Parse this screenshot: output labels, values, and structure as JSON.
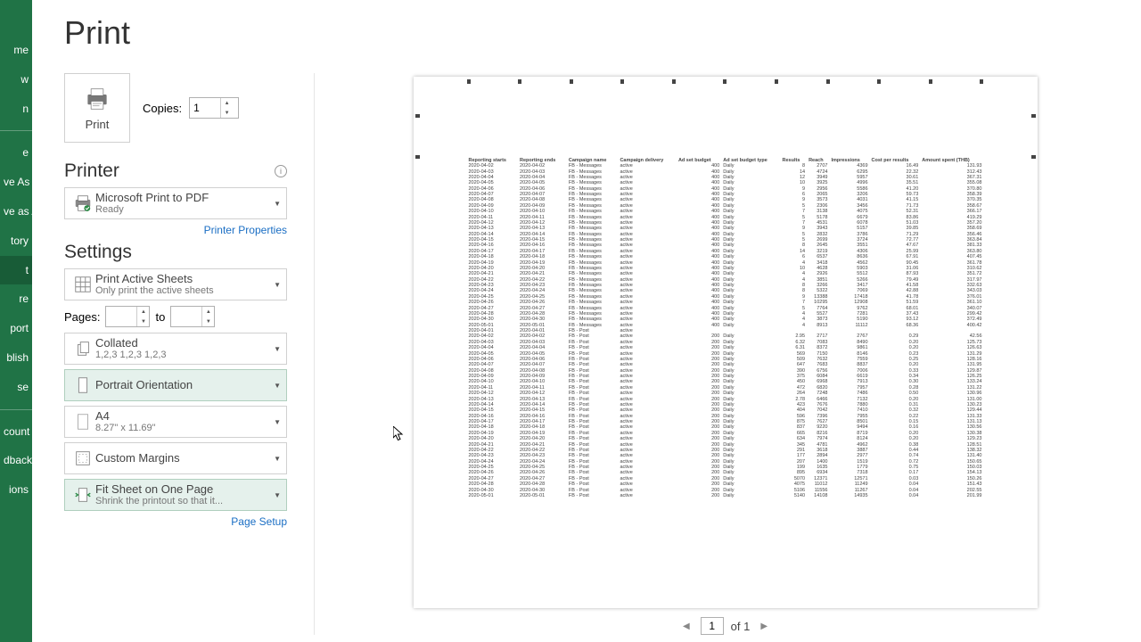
{
  "nav": {
    "items": [
      "me",
      "w",
      "n",
      "",
      "e",
      "ve As",
      "ve as Adobe\nF",
      "tory",
      "t",
      "re",
      "port",
      "blish",
      "se"
    ],
    "account_items": [
      "count",
      "dback",
      "ions"
    ],
    "selected_index": 8
  },
  "page_title": "Print",
  "print_button_label": "Print",
  "copies_label": "Copies:",
  "copies_value": "1",
  "printer": {
    "section": "Printer",
    "name": "Microsoft Print to PDF",
    "status": "Ready",
    "properties_link": "Printer Properties"
  },
  "settings": {
    "section": "Settings",
    "active_sheets": {
      "title": "Print Active Sheets",
      "sub": "Only print the active sheets"
    },
    "pages_label": "Pages:",
    "pages_to": "to",
    "collated": {
      "title": "Collated",
      "sub": "1,2,3    1,2,3    1,2,3"
    },
    "orientation": "Portrait Orientation",
    "paper": {
      "title": "A4",
      "sub": "8.27\" x 11.69\""
    },
    "margins": "Custom Margins",
    "fit": {
      "title": "Fit Sheet on One Page",
      "sub": "Shrink the printout so that it..."
    },
    "page_setup_link": "Page Setup"
  },
  "page_nav": {
    "current": "1",
    "total_text": "of 1"
  },
  "preview": {
    "headers": [
      "Reporting starts",
      "Reporting ends",
      "Campaign name",
      "Campaign delivery",
      "Ad set budget",
      "Ad set budget type",
      "Results",
      "Reach",
      "Impressions",
      "Cost per results",
      "Amount spent (THB)"
    ],
    "rows": [
      [
        "2020-04-02",
        "2020-04-02",
        "FB - Messages",
        "active",
        "400",
        "Daily",
        "8",
        "2707",
        "4369",
        "16.49",
        "131.93"
      ],
      [
        "2020-04-03",
        "2020-04-03",
        "FB - Messages",
        "active",
        "400",
        "Daily",
        "14",
        "4724",
        "6295",
        "22.32",
        "312.43"
      ],
      [
        "2020-04-04",
        "2020-04-04",
        "FB - Messages",
        "active",
        "400",
        "Daily",
        "12",
        "3949",
        "5957",
        "30.61",
        "367.31"
      ],
      [
        "2020-04-05",
        "2020-04-05",
        "FB - Messages",
        "active",
        "400",
        "Daily",
        "10",
        "3925",
        "4996",
        "35.51",
        "355.08"
      ],
      [
        "2020-04-06",
        "2020-04-06",
        "FB - Messages",
        "active",
        "400",
        "Daily",
        "9",
        "2956",
        "5586",
        "41.20",
        "370.80"
      ],
      [
        "2020-04-07",
        "2020-04-07",
        "FB - Messages",
        "active",
        "400",
        "Daily",
        "6",
        "2065",
        "3206",
        "59.73",
        "358.39"
      ],
      [
        "2020-04-08",
        "2020-04-08",
        "FB - Messages",
        "active",
        "400",
        "Daily",
        "9",
        "3573",
        "4031",
        "41.15",
        "370.35"
      ],
      [
        "2020-04-09",
        "2020-04-09",
        "FB - Messages",
        "active",
        "400",
        "Daily",
        "5",
        "2306",
        "3456",
        "71.73",
        "358.67"
      ],
      [
        "2020-04-10",
        "2020-04-10",
        "FB - Messages",
        "active",
        "400",
        "Daily",
        "7",
        "3138",
        "4075",
        "52.31",
        "366.17"
      ],
      [
        "2020-04-11",
        "2020-04-11",
        "FB - Messages",
        "active",
        "400",
        "Daily",
        "5",
        "5178",
        "6679",
        "83.86",
        "419.29"
      ],
      [
        "2020-04-12",
        "2020-04-12",
        "FB - Messages",
        "active",
        "400",
        "Daily",
        "7",
        "4531",
        "6078",
        "51.03",
        "357.20"
      ],
      [
        "2020-04-13",
        "2020-04-13",
        "FB - Messages",
        "active",
        "400",
        "Daily",
        "9",
        "3943",
        "5157",
        "39.85",
        "358.69"
      ],
      [
        "2020-04-14",
        "2020-04-14",
        "FB - Messages",
        "active",
        "400",
        "Daily",
        "5",
        "2832",
        "3786",
        "71.29",
        "356.46"
      ],
      [
        "2020-04-15",
        "2020-04-15",
        "FB - Messages",
        "active",
        "400",
        "Daily",
        "5",
        "2699",
        "3724",
        "72.77",
        "363.84"
      ],
      [
        "2020-04-16",
        "2020-04-16",
        "FB - Messages",
        "active",
        "400",
        "Daily",
        "8",
        "2645",
        "3551",
        "47.67",
        "381.33"
      ],
      [
        "2020-04-17",
        "2020-04-17",
        "FB - Messages",
        "active",
        "400",
        "Daily",
        "14",
        "3219",
        "4306",
        "25.99",
        "363.80"
      ],
      [
        "2020-04-18",
        "2020-04-18",
        "FB - Messages",
        "active",
        "400",
        "Daily",
        "6",
        "6537",
        "8636",
        "67.91",
        "407.45"
      ],
      [
        "2020-04-19",
        "2020-04-19",
        "FB - Messages",
        "active",
        "400",
        "Daily",
        "4",
        "3418",
        "4562",
        "90.45",
        "361.78"
      ],
      [
        "2020-04-20",
        "2020-04-20",
        "FB - Messages",
        "active",
        "400",
        "Daily",
        "10",
        "4628",
        "5903",
        "31.06",
        "310.62"
      ],
      [
        "2020-04-21",
        "2020-04-21",
        "FB - Messages",
        "active",
        "400",
        "Daily",
        "4",
        "2926",
        "5512",
        "87.93",
        "351.72"
      ],
      [
        "2020-04-22",
        "2020-04-22",
        "FB - Messages",
        "active",
        "400",
        "Daily",
        "4",
        "3851",
        "5266",
        "79.49",
        "317.97"
      ],
      [
        "2020-04-23",
        "2020-04-23",
        "FB - Messages",
        "active",
        "400",
        "Daily",
        "8",
        "3266",
        "3417",
        "41.58",
        "332.63"
      ],
      [
        "2020-04-24",
        "2020-04-24",
        "FB - Messages",
        "active",
        "400",
        "Daily",
        "8",
        "5322",
        "7069",
        "42.88",
        "343.03"
      ],
      [
        "2020-04-25",
        "2020-04-25",
        "FB - Messages",
        "active",
        "400",
        "Daily",
        "9",
        "13388",
        "17418",
        "41.78",
        "376.01"
      ],
      [
        "2020-04-26",
        "2020-04-26",
        "FB - Messages",
        "active",
        "400",
        "Daily",
        "7",
        "10295",
        "12908",
        "51.59",
        "361.10"
      ],
      [
        "2020-04-27",
        "2020-04-27",
        "FB - Messages",
        "active",
        "400",
        "Daily",
        "5",
        "7764",
        "9762",
        "68.01",
        "340.07"
      ],
      [
        "2020-04-28",
        "2020-04-28",
        "FB - Messages",
        "active",
        "400",
        "Daily",
        "4",
        "5527",
        "7281",
        "37.43",
        "299.42"
      ],
      [
        "2020-04-30",
        "2020-04-30",
        "FB - Messages",
        "active",
        "400",
        "Daily",
        "4",
        "3873",
        "5190",
        "93.12",
        "372.49"
      ],
      [
        "2020-05-01",
        "2020-05-01",
        "FB - Messages",
        "active",
        "400",
        "Daily",
        "4",
        "8913",
        "11112",
        "68.36",
        "400.42"
      ],
      [
        "2020-04-01",
        "2020-04-01",
        "FB - Post",
        "active",
        "",
        "",
        "",
        "",
        "",
        "",
        ""
      ],
      [
        "2020-04-02",
        "2020-04-02",
        "FB - Post",
        "active",
        "200",
        "Daily",
        "2.95",
        "2717",
        "2767",
        "0.29",
        "42.56"
      ],
      [
        "2020-04-03",
        "2020-04-03",
        "FB - Post",
        "active",
        "200",
        "Daily",
        "6.32",
        "7083",
        "8490",
        "0.20",
        "125.73"
      ],
      [
        "2020-04-04",
        "2020-04-04",
        "FB - Post",
        "active",
        "200",
        "Daily",
        "6.31",
        "8372",
        "9861",
        "0.20",
        "126.63"
      ],
      [
        "2020-04-05",
        "2020-04-05",
        "FB - Post",
        "active",
        "200",
        "Daily",
        "569",
        "7150",
        "8146",
        "0.23",
        "131.29"
      ],
      [
        "2020-04-06",
        "2020-04-06",
        "FB - Post",
        "active",
        "200",
        "Daily",
        "509",
        "7632",
        "7559",
        "0.25",
        "128.16"
      ],
      [
        "2020-04-07",
        "2020-04-07",
        "FB - Post",
        "active",
        "200",
        "Daily",
        "647",
        "7683",
        "8837",
        "0.20",
        "131.95"
      ],
      [
        "2020-04-08",
        "2020-04-08",
        "FB - Post",
        "active",
        "200",
        "Daily",
        "390",
        "6756",
        "7006",
        "0.33",
        "129.87"
      ],
      [
        "2020-04-09",
        "2020-04-09",
        "FB - Post",
        "active",
        "200",
        "Daily",
        "375",
        "6084",
        "6619",
        "0.34",
        "126.25"
      ],
      [
        "2020-04-10",
        "2020-04-10",
        "FB - Post",
        "active",
        "200",
        "Daily",
        "450",
        "6968",
        "7913",
        "0.30",
        "133.24"
      ],
      [
        "2020-04-11",
        "2020-04-11",
        "FB - Post",
        "active",
        "200",
        "Daily",
        "472",
        "6820",
        "7957",
        "0.28",
        "131.22"
      ],
      [
        "2020-04-12",
        "2020-04-12",
        "FB - Post",
        "active",
        "200",
        "Daily",
        "264",
        "7248",
        "7486",
        "0.50",
        "130.96"
      ],
      [
        "2020-04-13",
        "2020-04-13",
        "FB - Post",
        "active",
        "200",
        "Daily",
        "2.78",
        "6466",
        "7132",
        "0.20",
        "131.00"
      ],
      [
        "2020-04-14",
        "2020-04-14",
        "FB - Post",
        "active",
        "200",
        "Daily",
        "423",
        "7676",
        "7880",
        "0.31",
        "130.23"
      ],
      [
        "2020-04-15",
        "2020-04-15",
        "FB - Post",
        "active",
        "200",
        "Daily",
        "404",
        "7042",
        "7410",
        "0.32",
        "129.44"
      ],
      [
        "2020-04-16",
        "2020-04-16",
        "FB - Post",
        "active",
        "200",
        "Daily",
        "596",
        "7396",
        "7955",
        "0.22",
        "131.33"
      ],
      [
        "2020-04-17",
        "2020-04-17",
        "FB - Post",
        "active",
        "200",
        "Daily",
        "875",
        "7627",
        "8501",
        "0.15",
        "131.13"
      ],
      [
        "2020-04-18",
        "2020-04-18",
        "FB - Post",
        "active",
        "200",
        "Daily",
        "837",
        "9220",
        "9494",
        "0.16",
        "130.56"
      ],
      [
        "2020-04-19",
        "2020-04-19",
        "FB - Post",
        "active",
        "200",
        "Daily",
        "665",
        "8216",
        "8719",
        "0.20",
        "130.38"
      ],
      [
        "2020-04-20",
        "2020-04-20",
        "FB - Post",
        "active",
        "200",
        "Daily",
        "634",
        "7974",
        "8124",
        "0.20",
        "129.23"
      ],
      [
        "2020-04-21",
        "2020-04-21",
        "FB - Post",
        "active",
        "200",
        "Daily",
        "345",
        "4781",
        "4962",
        "0.38",
        "128.51"
      ],
      [
        "2020-04-22",
        "2020-04-22",
        "FB - Post",
        "active",
        "200",
        "Daily",
        "291",
        "3618",
        "3887",
        "0.44",
        "138.32"
      ],
      [
        "2020-04-23",
        "2020-04-23",
        "FB - Post",
        "active",
        "200",
        "Daily",
        "177",
        "2894",
        "2977",
        "0.74",
        "131.40"
      ],
      [
        "2020-04-24",
        "2020-04-24",
        "FB - Post",
        "active",
        "200",
        "Daily",
        "207",
        "1400",
        "1519",
        "0.72",
        "150.65"
      ],
      [
        "2020-04-25",
        "2020-04-25",
        "FB - Post",
        "active",
        "200",
        "Daily",
        "199",
        "1635",
        "1779",
        "0.75",
        "150.03"
      ],
      [
        "2020-04-26",
        "2020-04-26",
        "FB - Post",
        "active",
        "200",
        "Daily",
        "895",
        "6934",
        "7318",
        "0.17",
        "154.13"
      ],
      [
        "2020-04-27",
        "2020-04-27",
        "FB - Post",
        "active",
        "200",
        "Daily",
        "5070",
        "12371",
        "12571",
        "0.03",
        "150.26"
      ],
      [
        "2020-04-28",
        "2020-04-28",
        "FB - Post",
        "active",
        "200",
        "Daily",
        "4075",
        "11012",
        "11249",
        "0.04",
        "151.43"
      ],
      [
        "2020-04-30",
        "2020-04-30",
        "FB - Post",
        "active",
        "200",
        "Daily",
        "5106",
        "11556",
        "11267",
        "0.04",
        "202.55"
      ],
      [
        "2020-05-01",
        "2020-05-01",
        "FB - Post",
        "active",
        "200",
        "Daily",
        "5140",
        "14108",
        "14935",
        "0.04",
        "201.99"
      ]
    ]
  }
}
